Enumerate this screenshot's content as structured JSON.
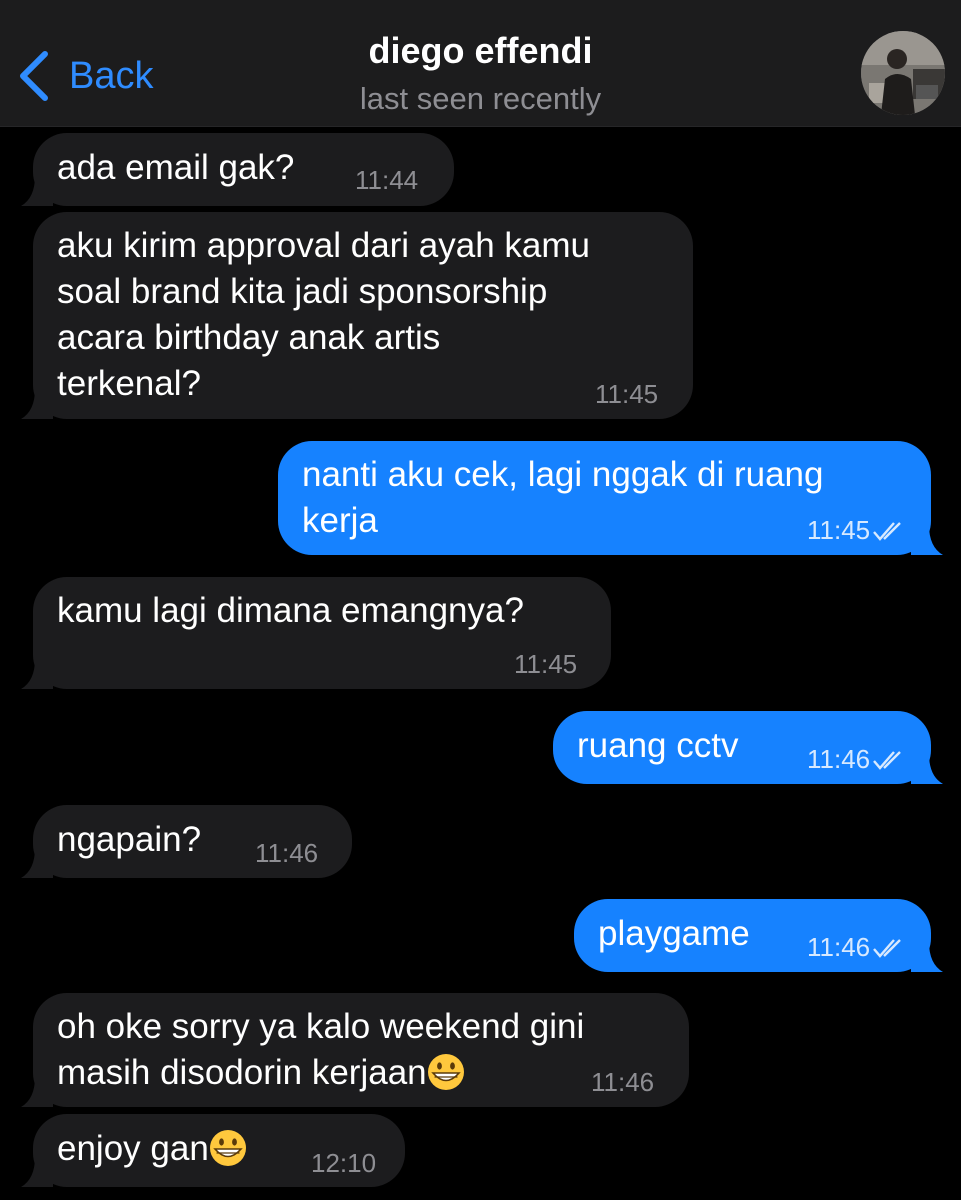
{
  "header": {
    "back_label": "Back",
    "contact_name": "diego effendi",
    "status": "last seen recently"
  },
  "colors": {
    "accent": "#2f8cff",
    "outgoing_bubble": "#1682ff",
    "incoming_bubble": "#1c1c1e",
    "background": "#000000"
  },
  "messages": [
    {
      "direction": "incoming",
      "text": "ada email gak?",
      "time": "11:44"
    },
    {
      "direction": "incoming",
      "text": "aku kirim approval dari ayah kamu\nsoal brand kita jadi sponsorship\nacara birthday anak artis\nterkenal?",
      "time": "11:45"
    },
    {
      "direction": "outgoing",
      "text": "nanti aku cek, lagi nggak di ruang\nkerja",
      "time": "11:45",
      "status_icon": "double-check-icon"
    },
    {
      "direction": "incoming",
      "text": "kamu lagi dimana emangnya?",
      "time": "11:45"
    },
    {
      "direction": "outgoing",
      "text": "ruang cctv",
      "time": "11:46",
      "status_icon": "double-check-icon"
    },
    {
      "direction": "incoming",
      "text": "ngapain?",
      "time": "11:46"
    },
    {
      "direction": "outgoing",
      "text": "playgame",
      "time": "11:46",
      "status_icon": "double-check-icon"
    },
    {
      "direction": "incoming",
      "text": "oh oke sorry ya kalo weekend gini",
      "text2": "masih disodorin kerjaan",
      "emoji": "grinning-face-icon",
      "time": "11:46"
    },
    {
      "direction": "incoming",
      "text": "enjoy gan",
      "emoji": "grinning-face-icon",
      "time": "12:10"
    }
  ]
}
